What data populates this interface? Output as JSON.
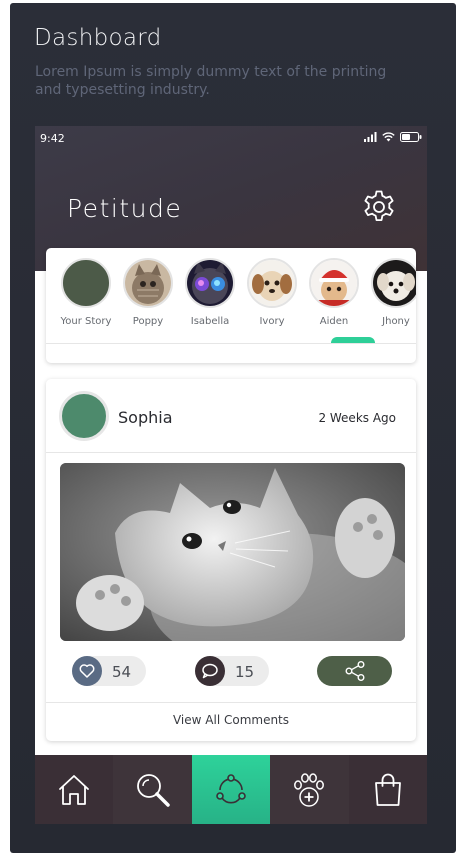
{
  "page": {
    "title": "Dashboard",
    "subtitle": "Lorem Ipsum is simply dummy text of the printing and typesetting industry."
  },
  "status_bar": {
    "time": "9:42"
  },
  "app": {
    "title": "Petitude"
  },
  "stories": [
    {
      "name": "Your Story",
      "avatar": "solid-green-circle",
      "color": "#4c5a48"
    },
    {
      "name": "Poppy",
      "avatar": "tabby-kitten-photo"
    },
    {
      "name": "Isabella",
      "avatar": "space-cat-photo"
    },
    {
      "name": "Ivory",
      "avatar": "puppy-photo"
    },
    {
      "name": "Aiden",
      "avatar": "kitten-santa-hat-photo",
      "selected": true
    },
    {
      "name": "Jhony",
      "avatar": "white-puppy-photo"
    }
  ],
  "post": {
    "author": "Sophia",
    "time": "2 Weeks Ago",
    "avatar_color": "#4d8a6c",
    "image": "grayscale-kitten-photo",
    "likes": "54",
    "comments": "15",
    "view_comments": "View All Comments"
  },
  "bottom_nav": [
    {
      "icon": "home-icon"
    },
    {
      "icon": "search-icon"
    },
    {
      "icon": "share-network-icon",
      "active": true
    },
    {
      "icon": "paw-add-icon"
    },
    {
      "icon": "shopping-bag-icon"
    }
  ],
  "colors": {
    "accent": "#2ecf98",
    "share_button": "#4e5f48",
    "like_icon_bg": "#5a6b84",
    "comment_icon_bg": "#3a2f35",
    "background": "#2a2d36"
  }
}
